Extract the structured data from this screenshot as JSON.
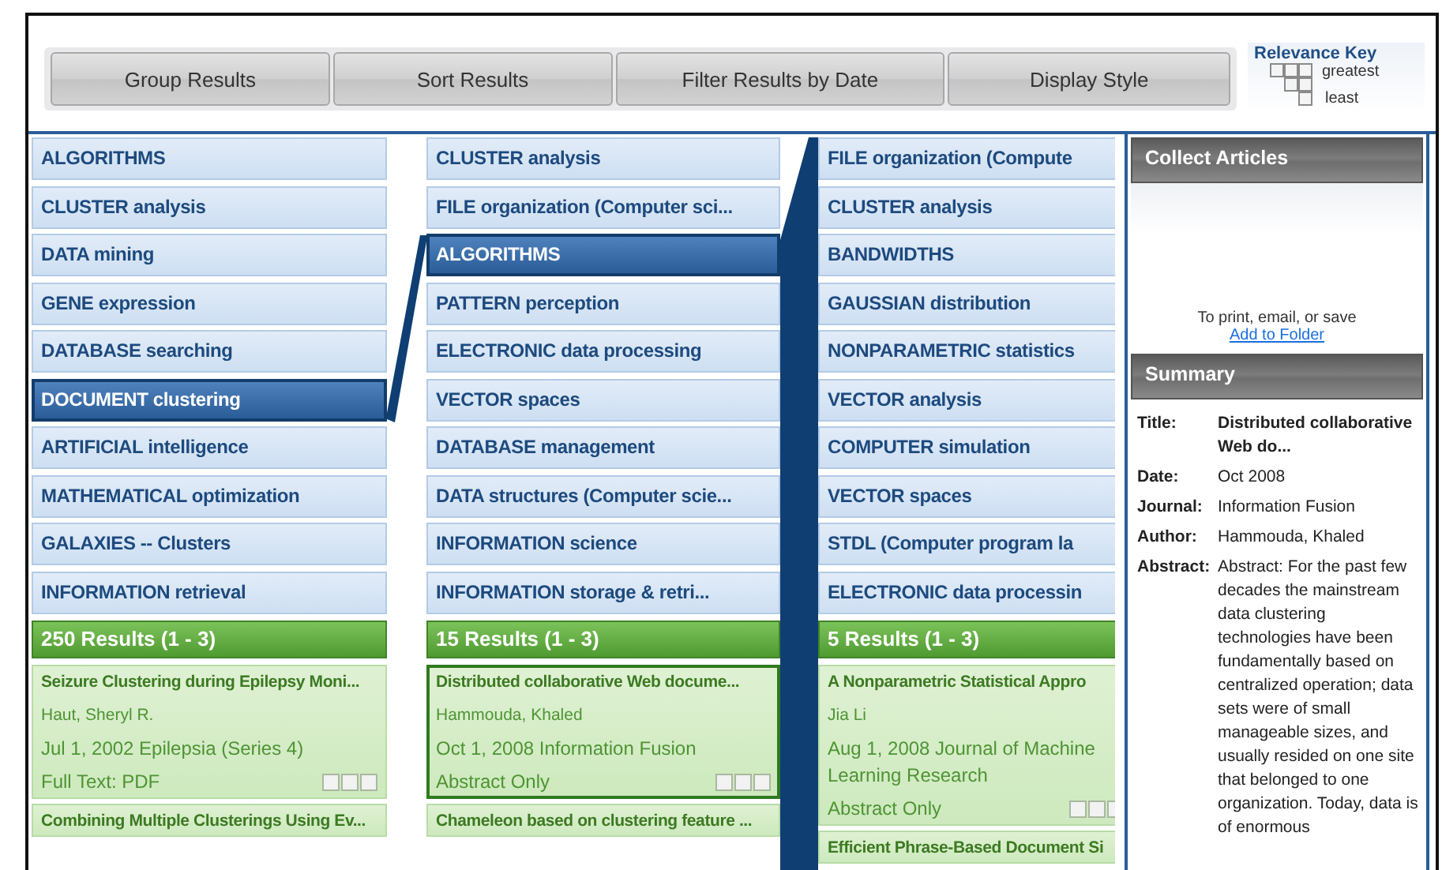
{
  "toolbar": {
    "buttons": [
      "Group Results",
      "Sort Results",
      "Filter Results by Date",
      "Display Style"
    ]
  },
  "relevance_key": {
    "title": "Relevance Key",
    "greatest": "greatest",
    "least": "least"
  },
  "columns": [
    {
      "terms": [
        {
          "label": "ALGORITHMS",
          "selected": false
        },
        {
          "label": "CLUSTER analysis",
          "selected": false
        },
        {
          "label": "DATA mining",
          "selected": false
        },
        {
          "label": "GENE expression",
          "selected": false
        },
        {
          "label": "DATABASE searching",
          "selected": false
        },
        {
          "label": "DOCUMENT clustering",
          "selected": true
        },
        {
          "label": "ARTIFICIAL intelligence",
          "selected": false
        },
        {
          "label": "MATHEMATICAL optimization",
          "selected": false
        },
        {
          "label": "GALAXIES -- Clusters",
          "selected": false
        },
        {
          "label": "INFORMATION retrieval",
          "selected": false
        }
      ],
      "results_header": "250 Results (1 - 3)",
      "results": [
        {
          "title": "Seizure Clustering during Epilepsy Moni...",
          "author": "Haut, Sheryl R.",
          "source": "Jul 1, 2002 Epilepsia (Series 4)",
          "access": "Full Text: PDF",
          "selected": false
        },
        {
          "title": "Combining Multiple Clusterings Using Ev...",
          "selected": false
        }
      ]
    },
    {
      "terms": [
        {
          "label": "CLUSTER analysis",
          "selected": false
        },
        {
          "label": "FILE organization (Computer sci...",
          "selected": false
        },
        {
          "label": "ALGORITHMS",
          "selected": true
        },
        {
          "label": "PATTERN perception",
          "selected": false
        },
        {
          "label": "ELECTRONIC data processing",
          "selected": false
        },
        {
          "label": "VECTOR spaces",
          "selected": false
        },
        {
          "label": "DATABASE management",
          "selected": false
        },
        {
          "label": "DATA structures (Computer scie...",
          "selected": false
        },
        {
          "label": "INFORMATION science",
          "selected": false
        },
        {
          "label": "INFORMATION storage & retri...",
          "selected": false
        }
      ],
      "results_header": "15 Results (1 - 3)",
      "results": [
        {
          "title": "Distributed collaborative Web docume...",
          "author": "Hammouda, Khaled",
          "source": "Oct 1, 2008 Information Fusion",
          "access": "Abstract Only",
          "selected": true
        },
        {
          "title": "Chameleon based on clustering feature ...",
          "selected": false
        }
      ]
    },
    {
      "terms": [
        {
          "label": "FILE organization (Compute",
          "selected": false
        },
        {
          "label": "CLUSTER analysis",
          "selected": false
        },
        {
          "label": "BANDWIDTHS",
          "selected": false
        },
        {
          "label": "GAUSSIAN distribution",
          "selected": false
        },
        {
          "label": "NONPARAMETRIC statistics",
          "selected": false
        },
        {
          "label": "VECTOR analysis",
          "selected": false
        },
        {
          "label": "COMPUTER simulation",
          "selected": false
        },
        {
          "label": "VECTOR spaces",
          "selected": false
        },
        {
          "label": "STDL (Computer program la",
          "selected": false
        },
        {
          "label": "ELECTRONIC data processin",
          "selected": false
        }
      ],
      "results_header": "5 Results (1 - 3)",
      "results": [
        {
          "title": "A Nonparametric Statistical Appro",
          "author": "Jia Li",
          "source": "Aug 1, 2008 Journal of Machine Learning Research",
          "access": "Abstract Only",
          "selected": false
        },
        {
          "title": "Efficient Phrase-Based Document Si",
          "selected": false
        }
      ]
    }
  ],
  "collect_articles": {
    "title": "Collect Articles",
    "note": "To print, email, or save",
    "link": "Add to Folder"
  },
  "summary": {
    "title": "Summary",
    "fields": [
      {
        "label": "Title:",
        "value": "Distributed collaborative Web do...",
        "kind": "bold"
      },
      {
        "label": "Date:",
        "value": "Oct 2008",
        "kind": "plain"
      },
      {
        "label": "Journal:",
        "value": "Information Fusion",
        "kind": "plain"
      },
      {
        "label": "Author:",
        "value": "Hammouda, Khaled",
        "kind": "plain"
      },
      {
        "label": "Abstract:",
        "value": "Abstract: For the past few decades the mainstream data clustering technologies have been fundamentally based on centralized operation; data sets were of small manageable sizes, and usually resided on one site that belonged to one organization. Today, data is of enormous",
        "kind": "plain"
      }
    ]
  }
}
